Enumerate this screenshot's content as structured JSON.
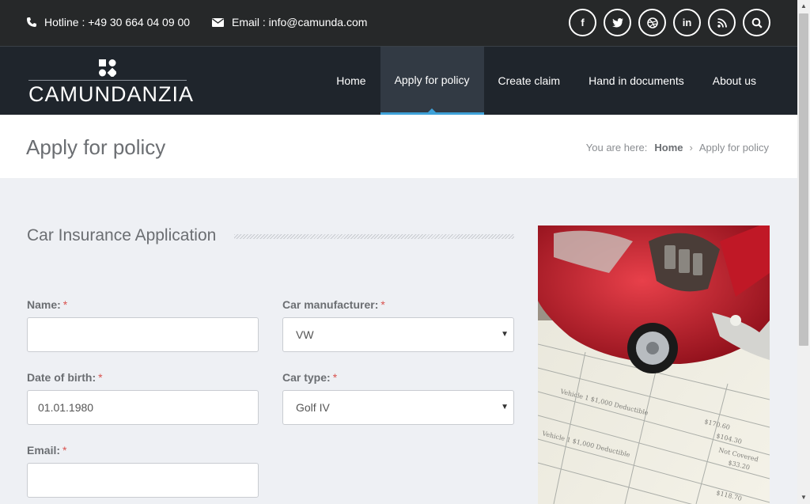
{
  "topbar": {
    "hotline": "Hotline : +49 30 664 04 09 00",
    "email": "Email : info@camunda.com",
    "social": [
      {
        "icon": "facebook-icon",
        "glyph": "f"
      },
      {
        "icon": "twitter-icon",
        "glyph": "t"
      },
      {
        "icon": "dribbble-icon",
        "glyph": "◎"
      },
      {
        "icon": "linkedin-icon",
        "glyph": "in"
      },
      {
        "icon": "rss-icon",
        "glyph": "))"
      },
      {
        "icon": "search-icon",
        "glyph": "⌕"
      }
    ]
  },
  "brand": {
    "bold": "CAMUNDA",
    "thin": "NZIA"
  },
  "nav": {
    "items": [
      "Home",
      "Apply for policy",
      "Create claim",
      "Hand in documents",
      "About us"
    ],
    "active": "Apply for policy",
    "accent": "#3ea1d8"
  },
  "page": {
    "title": "Apply for policy",
    "breadcrumb": {
      "prefix": "You are here:",
      "home": "Home",
      "separator": "›",
      "current": "Apply for policy"
    }
  },
  "form": {
    "title": "Car Insurance Application",
    "required_mark": "*",
    "name": {
      "label": "Name:",
      "value": ""
    },
    "dob": {
      "label": "Date of birth:",
      "value": "01.01.1980"
    },
    "email": {
      "label": "Email:",
      "value": ""
    },
    "manufacturer": {
      "label": "Car manufacturer:",
      "value": "VW"
    },
    "cartype": {
      "label": "Car type:",
      "value": "Golf IV"
    }
  },
  "photo": {
    "icon": "car-insurance-photo"
  }
}
